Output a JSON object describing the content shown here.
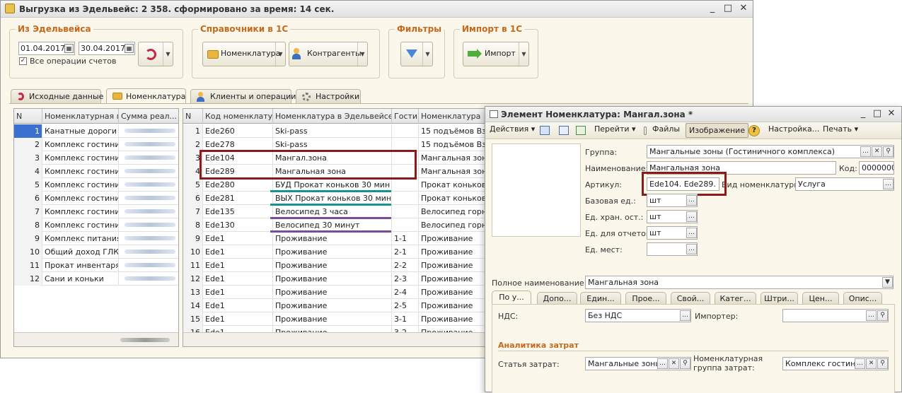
{
  "main_window": {
    "title": "Выгрузка из Эдельвейс: 2 358. сформировано за время: 14 сек.",
    "groups": {
      "edelweiss": {
        "label": "Из Эдельвейса",
        "date_from": "01.04.2017",
        "date_to": "30.04.2017",
        "all_ops_label": "Все операции счетов"
      },
      "references": {
        "label": "Справочники в 1С",
        "nomenclature_btn": "Номенклатура",
        "contractors_btn": "Контрагенты"
      },
      "filters": {
        "label": "Фильтры"
      },
      "import": {
        "label": "Импорт в 1С",
        "import_btn": "Импорт"
      }
    },
    "tabs": [
      "Исходные данные",
      "Номенклатура",
      "Клиенты и операции",
      "Настройки"
    ],
    "left_grid": {
      "headers": [
        "N",
        "Номенклатурная гру",
        "Сумма реал..."
      ],
      "rows": [
        {
          "n": "1",
          "name": "Канатные дороги"
        },
        {
          "n": "2",
          "name": "Комплекс гостиничн"
        },
        {
          "n": "3",
          "name": "Комплекс гостиничн"
        },
        {
          "n": "4",
          "name": "Комплекс гостиничн"
        },
        {
          "n": "5",
          "name": "Комплекс гостиничн"
        },
        {
          "n": "6",
          "name": "Комплекс гостиничн"
        },
        {
          "n": "7",
          "name": "Комплекс гостиничн"
        },
        {
          "n": "8",
          "name": "Комплекс гостиничн"
        },
        {
          "n": "9",
          "name": "Комплекс питания"
        },
        {
          "n": "10",
          "name": "Общий доход ГЛК"
        },
        {
          "n": "11",
          "name": "Прокат инвентаря"
        },
        {
          "n": "12",
          "name": "Сани и коньки"
        }
      ]
    },
    "right_grid": {
      "headers": [
        "N",
        "Код номенклату...",
        "Номенклатура в Эдельвейсе",
        "Гости",
        "Номенклатура"
      ],
      "rows": [
        {
          "n": "1",
          "code": "Ede260",
          "name": "Ski-pass",
          "g": "",
          "nom": "15 подъёмов Взро"
        },
        {
          "n": "2",
          "code": "Ede278",
          "name": "Ski-pass",
          "g": "",
          "nom": "15 подъёмов Взро"
        },
        {
          "n": "3",
          "code": "Ede104",
          "name": "Мангал.зона",
          "g": "",
          "nom": "Мангальная зона"
        },
        {
          "n": "4",
          "code": "Ede289",
          "name": "Мангальная зона",
          "g": "",
          "nom": "Мангальная зона"
        },
        {
          "n": "5",
          "code": "Ede280",
          "name": "БУД Прокат коньков 30 мин",
          "g": "",
          "nom": "Прокат коньков"
        },
        {
          "n": "6",
          "code": "Ede281",
          "name": "ВЫХ Прокат коньков 30 мин",
          "g": "",
          "nom": "Прокат коньков"
        },
        {
          "n": "7",
          "code": "Ede135",
          "name": "Велосипед 3 часа",
          "g": "",
          "nom": "Велосипед горны"
        },
        {
          "n": "8",
          "code": "Ede130",
          "name": "Велосипед 30 минут",
          "g": "",
          "nom": "Велосипед горны"
        },
        {
          "n": "9",
          "code": "Ede1",
          "name": "Проживание",
          "g": "1-1",
          "nom": "Проживание"
        },
        {
          "n": "10",
          "code": "Ede1",
          "name": "Проживание",
          "g": "2-1",
          "nom": "Проживание"
        },
        {
          "n": "11",
          "code": "Ede1",
          "name": "Проживание",
          "g": "2-2",
          "nom": "Проживание"
        },
        {
          "n": "12",
          "code": "Ede1",
          "name": "Проживание",
          "g": "2-3",
          "nom": "Проживание"
        },
        {
          "n": "13",
          "code": "Ede1",
          "name": "Проживание",
          "g": "2-4",
          "nom": "Проживание"
        },
        {
          "n": "14",
          "code": "Ede1",
          "name": "Проживание",
          "g": "2-5",
          "nom": "Проживание"
        },
        {
          "n": "15",
          "code": "Ede1",
          "name": "Проживание",
          "g": "3-1",
          "nom": "Проживание"
        },
        {
          "n": "16",
          "code": "Ede1",
          "name": "Проживание",
          "g": "3-2",
          "nom": "Проживание"
        }
      ]
    }
  },
  "element_window": {
    "title": "Элемент Номенклатура: Мангал.зона *",
    "toolbar": {
      "actions": "Действия",
      "goto": "Перейти",
      "files": "Файлы",
      "image": "Изображение",
      "settings": "Настройка...",
      "print": "Печать"
    },
    "fields": {
      "group_label": "Группа:",
      "group_value": "Мангальные зоны (Гостиничного комплекса)",
      "name_label": "Наименование:",
      "name_value": "Мангальная зона",
      "code_label": "Код:",
      "code_value": "0000000",
      "article_label": "Артикул:",
      "article_value": "Ede104. Ede289. E",
      "kind_label": "Вид номенклатуры:",
      "kind_value": "Услуга",
      "base_unit_label": "Базовая ед.:",
      "base_unit_value": "шт",
      "storage_unit_label": "Ед. хран. ост.:",
      "storage_unit_value": "шт",
      "report_unit_label": "Ед. для отчетов:",
      "report_unit_value": "шт",
      "place_unit_label": "Ед. мест:",
      "place_unit_value": "",
      "full_name_label": "Полное наименование:",
      "full_name_value": "Мангальная зона"
    },
    "tabs": [
      "По у...",
      "Допо...",
      "Един...",
      "Прое...",
      "Свой...",
      "Катег...",
      "Штри...",
      "Цен...",
      "Опис..."
    ],
    "vat_label": "НДС:",
    "vat_value": "Без НДС",
    "importer_label": "Импортер:",
    "importer_value": "",
    "cost_section": "Аналитика затрат",
    "cost_item_label": "Статья затрат:",
    "cost_item_value": "Мангальные зоны (",
    "nom_group_label": "Номенклатурная группа затрат:",
    "nom_group_value": "Комплекс гостинич"
  },
  "colors": {
    "accent": "#c46a1d",
    "highlight_red": "#8b1b1b",
    "teal": "#16948a",
    "purple": "#7a4d9a",
    "selected": "#3b6fd0"
  }
}
